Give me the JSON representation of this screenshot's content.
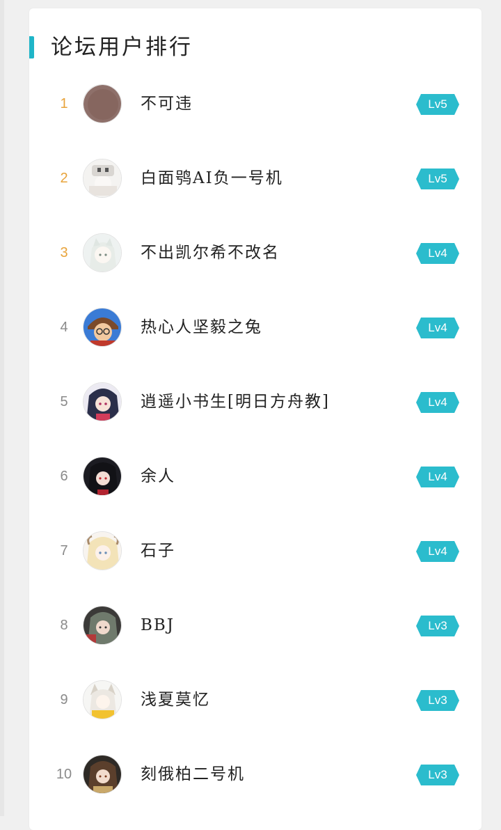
{
  "ranking": {
    "title": "论坛用户排行",
    "accent_color": "#1fb5c8",
    "top3_rank_color": "#e8a33a",
    "badge_color": "#2bbccd",
    "users": [
      {
        "rank": "1",
        "name": "不可违",
        "level": "Lv5"
      },
      {
        "rank": "2",
        "name": "白面鸮AI负一号机",
        "level": "Lv5"
      },
      {
        "rank": "3",
        "name": "不出凯尔希不改名",
        "level": "Lv4"
      },
      {
        "rank": "4",
        "name": "热心人坚毅之兔",
        "level": "Lv4"
      },
      {
        "rank": "5",
        "name": "逍遥小书生[明日方舟教]",
        "level": "Lv4"
      },
      {
        "rank": "6",
        "name": "余人",
        "level": "Lv4"
      },
      {
        "rank": "7",
        "name": "石子",
        "level": "Lv4"
      },
      {
        "rank": "8",
        "name": "BBJ",
        "level": "Lv3"
      },
      {
        "rank": "9",
        "name": "浅夏莫忆",
        "level": "Lv3"
      },
      {
        "rank": "10",
        "name": "刻俄柏二号机",
        "level": "Lv3"
      }
    ]
  }
}
